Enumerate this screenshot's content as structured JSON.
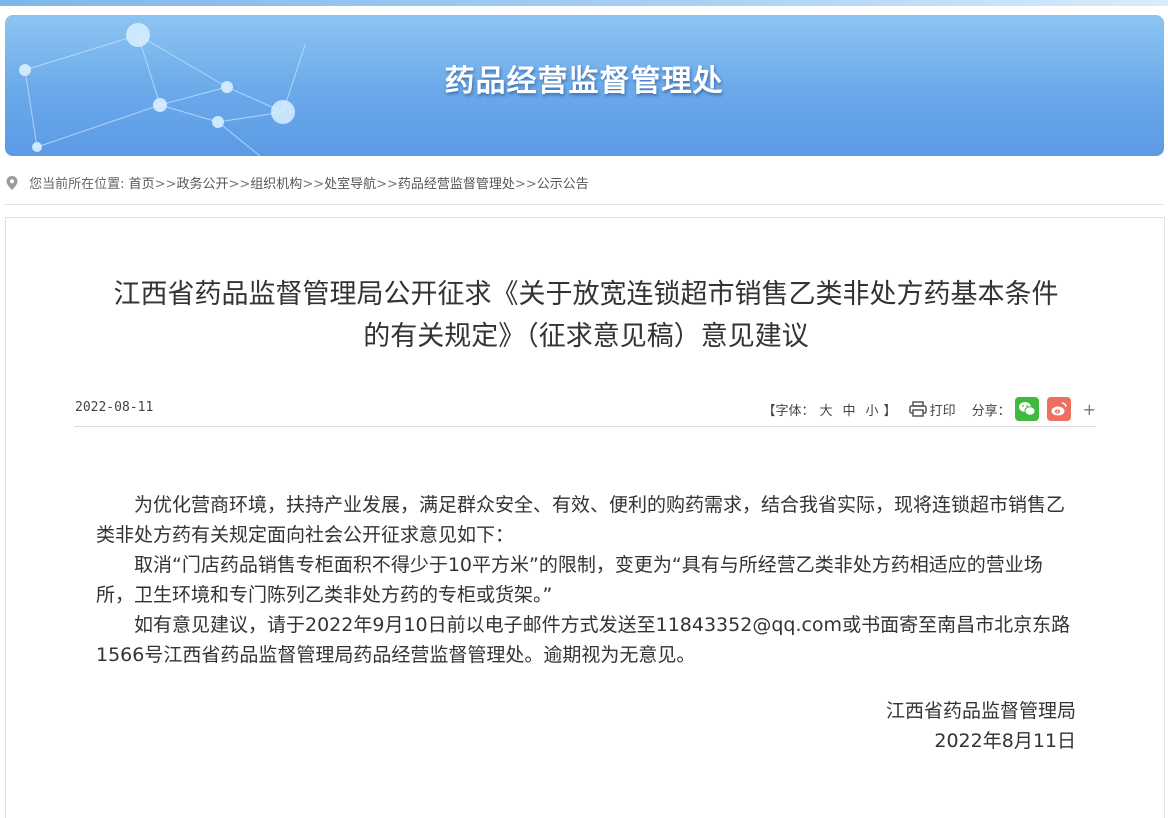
{
  "banner": {
    "title": "药品经营监督管理处"
  },
  "breadcrumb": {
    "prefix": "您当前所在位置:",
    "items": [
      "首页",
      "政务公开",
      "组织机构",
      "处室导航",
      "药品经营监督管理处",
      "公示公告"
    ],
    "separator": ">>"
  },
  "article": {
    "title_line1": "江西省药品监督管理局公开征求《关于放宽连锁超市销售乙类非处方药基本条件",
    "title_line2": "的有关规定》（征求意见稿）意见建议",
    "date": "2022-08-11",
    "paragraphs": [
      "为优化营商环境，扶持产业发展，满足群众安全、有效、便利的购药需求，结合我省实际，现将连锁超市销售乙类非处方药有关规定面向社会公开征求意见如下：",
      "取消“门店药品销售专柜面积不得少于10平方米”的限制，变更为“具有与所经营乙类非处方药相适应的营业场所，卫生环境和专门陈列乙类非处方药的专柜或货架。”",
      "如有意见建议，请于2022年9月10日前以电子邮件方式发送至11843352@qq.com或书面寄至南昌市北京东路1566号江西省药品监督管理局药品经营监督管理处。逾期视为无意见。"
    ],
    "signature_org": "江西省药品监督管理局",
    "signature_date": "2022年8月11日"
  },
  "tools": {
    "font_label": "【字体：",
    "font_large": "大",
    "font_medium": "中",
    "font_small": "小",
    "font_close": "】",
    "print_label": "打印",
    "share_label": "分享：",
    "more": "+"
  },
  "icons": [
    "location-pin-icon",
    "print-icon",
    "wechat-icon",
    "weibo-icon"
  ],
  "colors": {
    "banner_blue": "#6aa9ea",
    "wechat_green": "#3fba3f",
    "weibo_red": "#ec6f5f"
  }
}
